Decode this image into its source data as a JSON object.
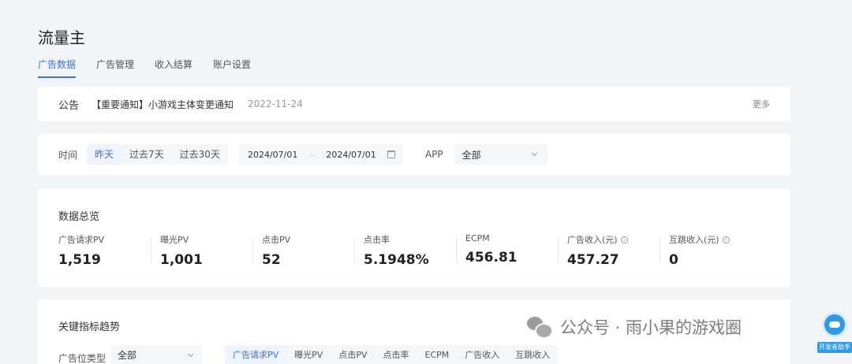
{
  "page": {
    "title": "流量主"
  },
  "nav": {
    "tabs": [
      {
        "label": "广告数据",
        "active": true
      },
      {
        "label": "广告管理"
      },
      {
        "label": "收入结算"
      },
      {
        "label": "账户设置"
      }
    ]
  },
  "notice": {
    "label": "公告",
    "text": "【重要通知】小游戏主体变更通知",
    "date": "2022-11-24",
    "more": "更多"
  },
  "filters": {
    "time_label": "时间",
    "ranges": [
      {
        "label": "昨天",
        "active": true
      },
      {
        "label": "过去7天"
      },
      {
        "label": "过去30天"
      }
    ],
    "date_start": "2024/07/01",
    "date_sep": "-",
    "date_end": "2024/07/01",
    "app_label": "APP",
    "app_value": "全部"
  },
  "overview": {
    "title": "数据总览",
    "metrics": [
      {
        "label": "广告请求PV",
        "value": "1,519"
      },
      {
        "label": "曝光PV",
        "value": "1,001"
      },
      {
        "label": "点击PV",
        "value": "52"
      },
      {
        "label": "点击率",
        "value": "5.1948%"
      },
      {
        "label": "ECPM",
        "value": "456.81"
      },
      {
        "label": "广告收入(元)",
        "value": "457.27",
        "info": true
      },
      {
        "label": "互跳收入(元)",
        "value": "0",
        "info": true
      }
    ]
  },
  "trend": {
    "title": "关键指标趋势",
    "adtype_label": "广告位类型",
    "adtype_value": "全部",
    "metric_tabs": [
      {
        "label": "广告请求PV",
        "active": true
      },
      {
        "label": "曝光PV"
      },
      {
        "label": "点击PV"
      },
      {
        "label": "点击率"
      },
      {
        "label": "ECPM"
      },
      {
        "label": "广告收入"
      },
      {
        "label": "互跳收入"
      }
    ]
  },
  "watermark": {
    "text": "公众号 · 雨小果的游戏圈",
    "badge_label": "开发者助手"
  },
  "colors": {
    "accent": "#3a73e6",
    "background": "#f3f4f6"
  }
}
